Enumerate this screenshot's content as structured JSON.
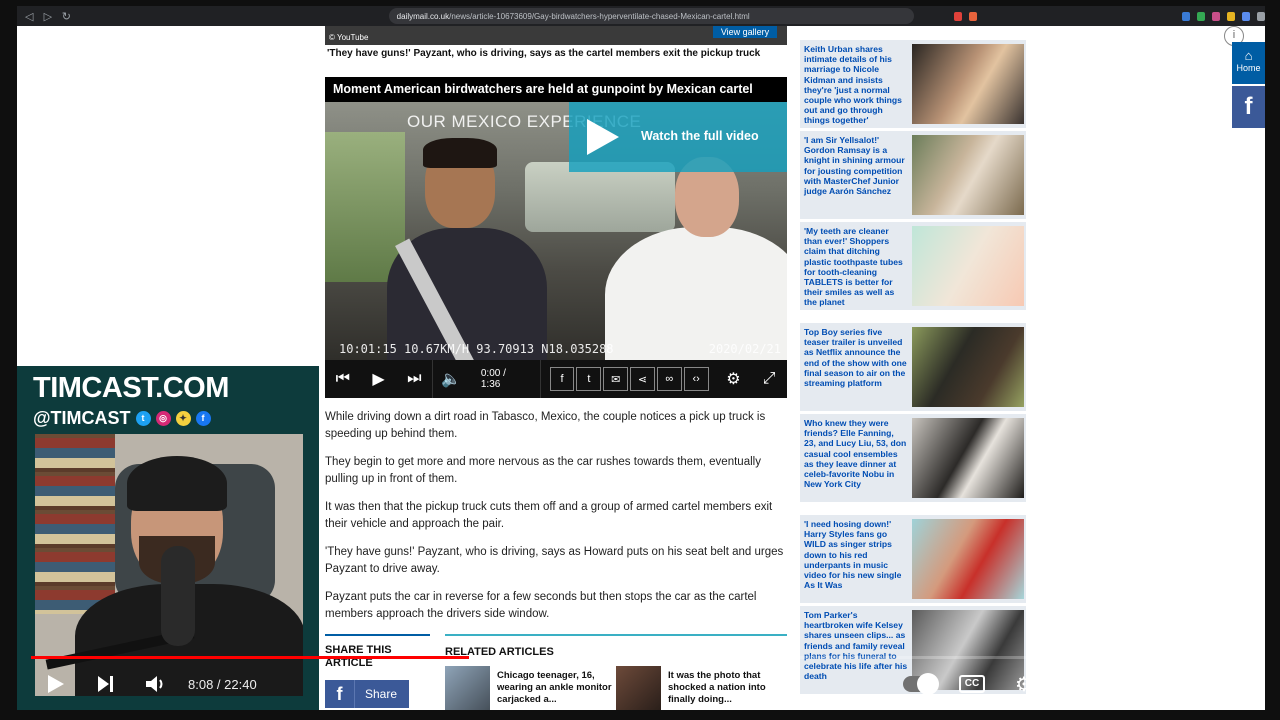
{
  "browser": {
    "url_host": "dailymail.co.uk",
    "url_path": "/news/article-10673609/Gay-birdwatchers-hyperventilate-chased-Mexican-cartel.html"
  },
  "article": {
    "prev_credit": "© YouTube",
    "view_gallery": "View gallery",
    "prev_caption": "'They have guns!' Payzant, who is driving, says as the cartel members exit the pickup truck",
    "video_title": "Moment American birdwatchers are held at gunpoint by Mexican cartel",
    "video_overlay_text": "OUR MEXICO EXPERIENCE",
    "watch_full_video": "Watch the full video",
    "video_stamp_left": "10:01:15  10.67KM/H  93.70913  N18.035288",
    "video_stamp_right": "2020/02/21",
    "player_time": "0:00 / 1:36",
    "paragraphs": [
      "While driving down a dirt road in Tabasco, Mexico, the couple notices a pick up truck is speeding up behind them.",
      "They begin to get more and more nervous as the car rushes towards them, eventually pulling up in front of them.",
      "It was then that the pickup truck cuts them off and a group of armed cartel members exit their vehicle and approach the pair.",
      "'They have guns!' Payzant, who is driving, says as Howard puts on his seat belt and urges Payzant to drive away.",
      "Payzant puts the car in reverse for a few seconds but then stops the car as the cartel members approach the drivers side window."
    ],
    "share_heading": "SHARE THIS ARTICLE",
    "share_button": "Share",
    "related_heading": "RELATED ARTICLES",
    "related": [
      {
        "text": "Chicago teenager, 16, wearing an ankle monitor carjacked a..."
      },
      {
        "text": "It was the photo that shocked a nation into finally doing..."
      }
    ]
  },
  "sidebar": {
    "puffs": [
      {
        "text": "Keith Urban shares intimate details of his marriage to Nicole Kidman and insists they're 'just a normal couple who work things out and go through things together'"
      },
      {
        "text": "'I am Sir Yellsalot!' Gordon Ramsay is a knight in shining armour for jousting competition with MasterChef Junior judge Aarón Sánchez"
      },
      {
        "text": "'My teeth are cleaner than ever!' Shoppers claim that ditching plastic toothpaste tubes for tooth-cleaning TABLETS is better for their smiles as well as the planet"
      },
      {
        "text": "Top Boy series five teaser trailer is unveiled as Netflix announce the end of the show with one final season to air on the streaming platform"
      },
      {
        "text": "Who knew they were friends? Elle Fanning, 23, and Lucy Liu, 53, don casual cool ensembles as they leave dinner at celeb-favorite Nobu in New York City"
      },
      {
        "text": "'I need hosing down!' Harry Styles fans go WILD as singer strips down to his red underpants in music video for his new single As It Was"
      },
      {
        "text": "Tom Parker's heartbroken wife Kelsey shares unseen clips... as friends and family reveal plans for his funeral to celebrate his life after his death"
      }
    ],
    "home_label": "Home",
    "fb_label": "f"
  },
  "overlay": {
    "site": "TIMCAST.COM",
    "handle": "@TIMCAST"
  },
  "youtube": {
    "current_time": "8:08",
    "duration": "22:40",
    "played_fraction": 0.359,
    "loaded_fraction": 0.5
  }
}
